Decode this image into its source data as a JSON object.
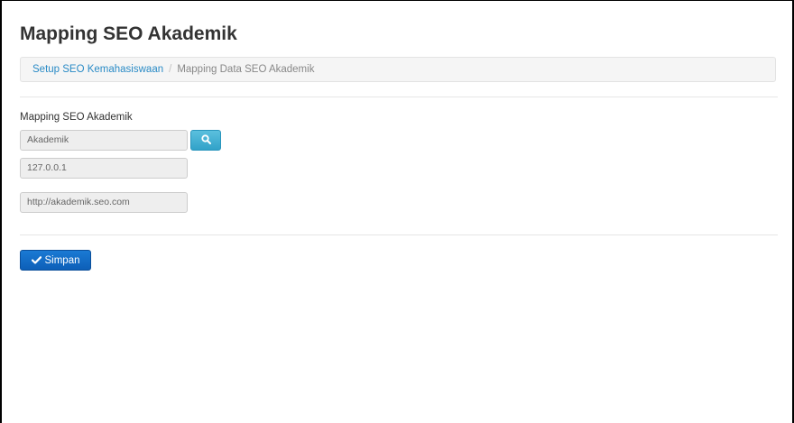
{
  "header": {
    "title": "Mapping SEO Akademik"
  },
  "breadcrumb": {
    "items": [
      {
        "label": "Setup SEO Kemahasiswaan"
      },
      {
        "label": "Mapping Data SEO Akademik"
      }
    ],
    "separator": "/"
  },
  "form": {
    "label": "Mapping SEO Akademik",
    "field_akademik": {
      "value": "Akademik"
    },
    "field_ip": {
      "value": "127.0.0.1"
    },
    "field_url": {
      "value": "http://akademik.seo.com"
    },
    "search_icon": "search-icon",
    "save_label": "Simpan",
    "save_icon": "check-icon"
  },
  "colors": {
    "link": "#2a8bc6",
    "search_button": "#46b8da",
    "save_button": "#1467c6"
  }
}
